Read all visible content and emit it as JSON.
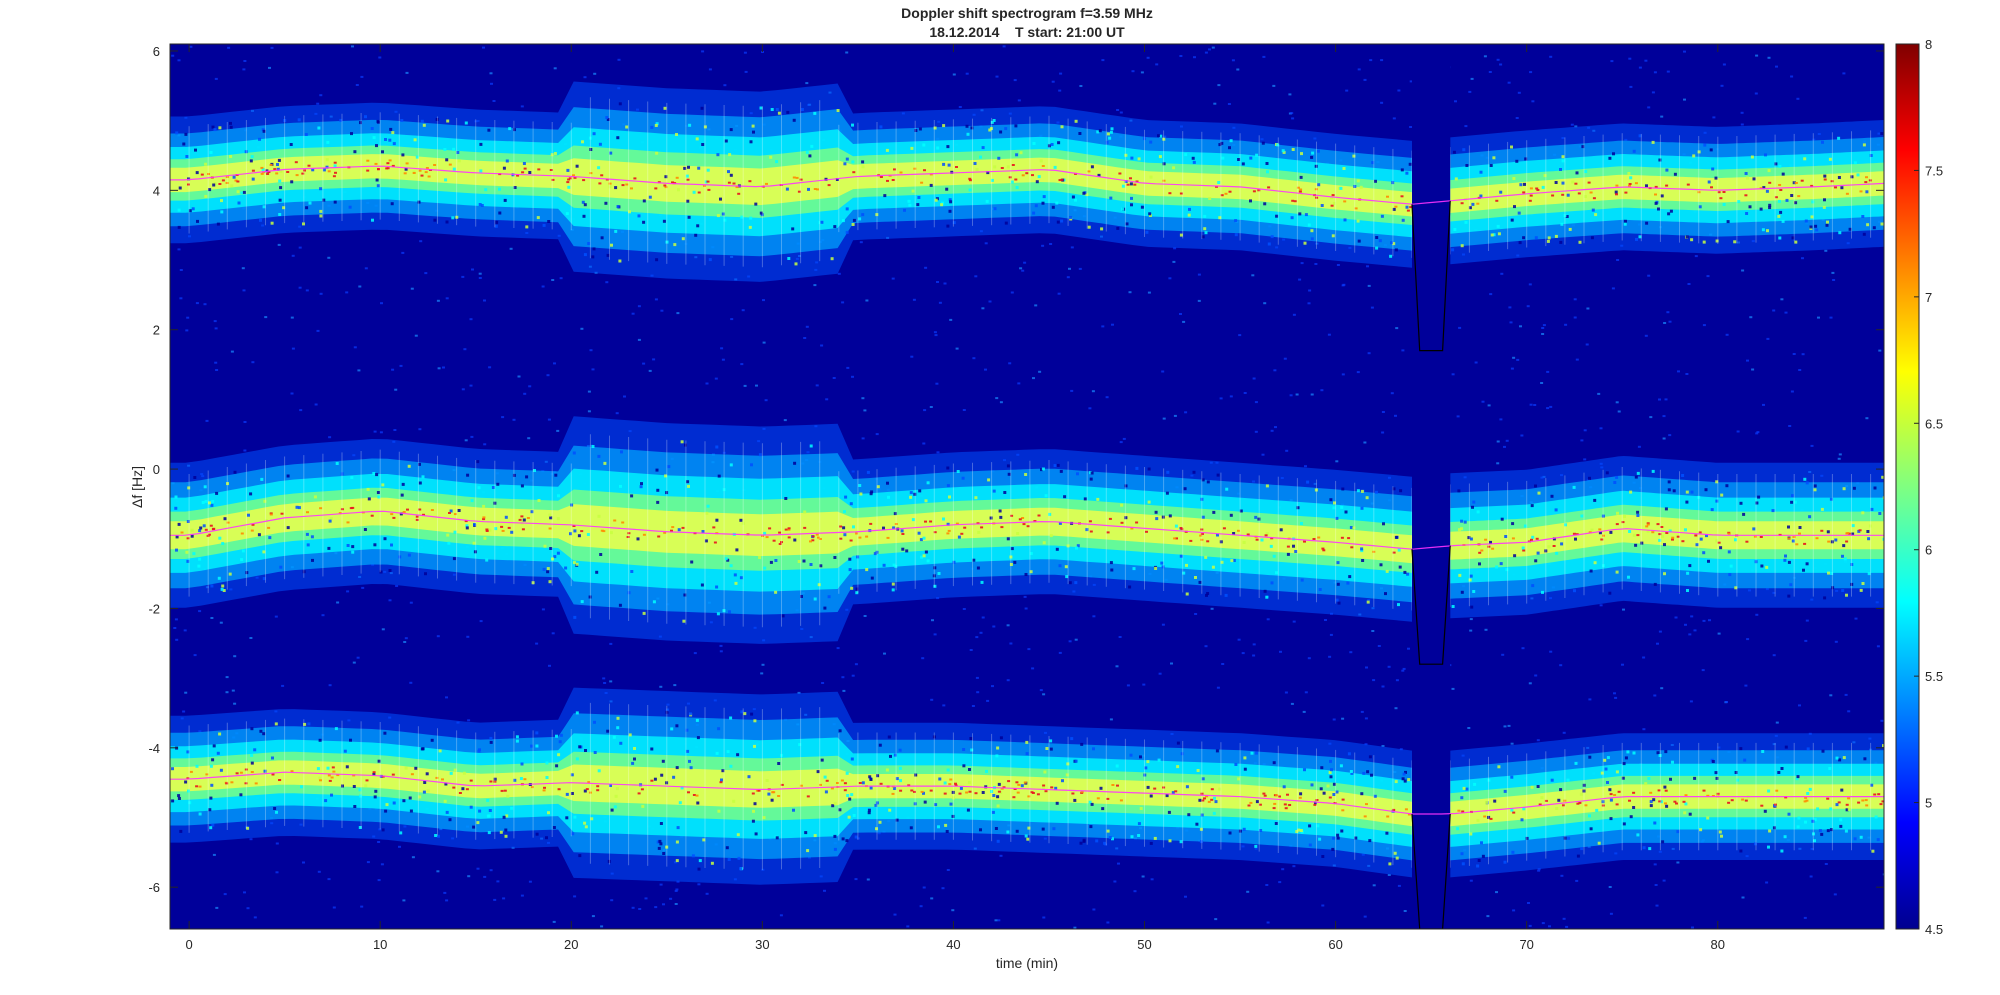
{
  "chart_data": {
    "type": "heatmap",
    "title": "Doppler shift spectrogram f=3.59 MHz",
    "subtitle": "18.12.2014    T start: 21:00 UT",
    "xlabel": "time (min)",
    "ylabel": "Δf [Hz]",
    "xlim": [
      -1,
      88.7
    ],
    "ylim": [
      -6.6,
      6.1
    ],
    "x_ticks": [
      0,
      10,
      20,
      30,
      40,
      50,
      60,
      70,
      80
    ],
    "y_ticks": [
      6,
      4,
      2,
      0,
      -2,
      -4,
      -6
    ],
    "colorbar": {
      "colormap": "jet",
      "clim": [
        4.5,
        8
      ],
      "ticks": [
        8,
        7.5,
        7,
        6.5,
        6,
        5.5,
        5,
        4.5
      ]
    },
    "data_gap_min": [
      64,
      66
    ],
    "bands": [
      {
        "center_hz": [
          [
            0,
            4.15
          ],
          [
            5,
            4.3
          ],
          [
            10,
            4.35
          ],
          [
            15,
            4.25
          ],
          [
            20,
            4.2
          ],
          [
            25,
            4.1
          ],
          [
            30,
            4.05
          ],
          [
            35,
            4.2
          ],
          [
            40,
            4.25
          ],
          [
            45,
            4.3
          ],
          [
            50,
            4.1
          ],
          [
            55,
            4.05
          ],
          [
            60,
            3.9
          ],
          [
            64,
            3.8
          ],
          [
            66,
            3.85
          ],
          [
            70,
            3.95
          ],
          [
            75,
            4.05
          ],
          [
            80,
            4.0
          ],
          [
            85,
            4.05
          ],
          [
            88.7,
            4.1
          ]
        ],
        "half_width_hz": 0.35
      },
      {
        "center_hz": [
          [
            0,
            -0.95
          ],
          [
            5,
            -0.7
          ],
          [
            10,
            -0.6
          ],
          [
            15,
            -0.75
          ],
          [
            20,
            -0.8
          ],
          [
            25,
            -0.9
          ],
          [
            30,
            -0.95
          ],
          [
            35,
            -0.9
          ],
          [
            40,
            -0.8
          ],
          [
            45,
            -0.75
          ],
          [
            50,
            -0.85
          ],
          [
            55,
            -0.95
          ],
          [
            60,
            -1.05
          ],
          [
            64,
            -1.15
          ],
          [
            66,
            -1.1
          ],
          [
            70,
            -1.05
          ],
          [
            75,
            -0.85
          ],
          [
            80,
            -0.95
          ],
          [
            85,
            -0.95
          ],
          [
            88.7,
            -0.95
          ]
        ],
        "half_width_hz": 0.4
      },
      {
        "center_hz": [
          [
            0,
            -4.45
          ],
          [
            5,
            -4.35
          ],
          [
            10,
            -4.4
          ],
          [
            15,
            -4.55
          ],
          [
            20,
            -4.5
          ],
          [
            25,
            -4.55
          ],
          [
            30,
            -4.6
          ],
          [
            35,
            -4.55
          ],
          [
            40,
            -4.55
          ],
          [
            45,
            -4.6
          ],
          [
            50,
            -4.65
          ],
          [
            55,
            -4.7
          ],
          [
            60,
            -4.8
          ],
          [
            64,
            -4.95
          ],
          [
            66,
            -4.95
          ],
          [
            70,
            -4.85
          ],
          [
            75,
            -4.7
          ],
          [
            80,
            -4.7
          ],
          [
            85,
            -4.7
          ],
          [
            88.7,
            -4.7
          ]
        ],
        "half_width_hz": 0.35
      }
    ],
    "fitted_line_color": "#ff33ff",
    "fitted_line_gap_min": [
      64,
      66
    ],
    "band_peak_color": "#e8141e",
    "background_color": "#00009a"
  }
}
